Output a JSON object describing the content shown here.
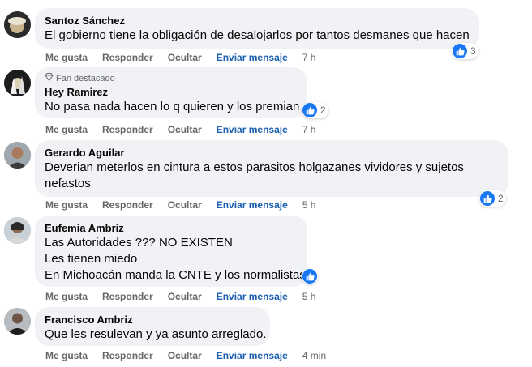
{
  "labels": {
    "like": "Me gusta",
    "reply": "Responder",
    "hide": "Ocultar",
    "send_message": "Enviar mensaje",
    "top_fan": "Fan destacado"
  },
  "colors": {
    "bubble": "#f0f2f5",
    "link_blue": "#1a5eb0",
    "like_blue": "#1877f2",
    "muted": "#65676b"
  },
  "comments": [
    {
      "author": "Santoz Sánchez",
      "lines": [
        "El gobierno tiene la obligación de desalojarlos por tantos desmanes que hacen"
      ],
      "time": "7 h",
      "reactions": "3"
    },
    {
      "author": "Hey Ramirez",
      "badge": "Fan destacado",
      "lines": [
        "No pasa nada hacen lo q quieren y los premian"
      ],
      "time": "7 h",
      "reactions": "2"
    },
    {
      "author": "Gerardo Aguilar",
      "lines": [
        "Deverian meterlos en cintura a estos parasitos holgazanes vividores y sujetos",
        "nefastos"
      ],
      "time": "5 h",
      "reactions": "2"
    },
    {
      "author": "Eufemia Ambriz",
      "lines": [
        "Las Autoridades ??? NO EXISTEN",
        "Les tienen miedo",
        "En Michoacán manda la CNTE y los normalistas"
      ],
      "time": "5 h",
      "reactions": ""
    },
    {
      "author": "Francisco Ambriz",
      "lines": [
        "Que les resulevan y ya asunto arreglado."
      ],
      "time": "4 min",
      "reactions": ""
    }
  ]
}
